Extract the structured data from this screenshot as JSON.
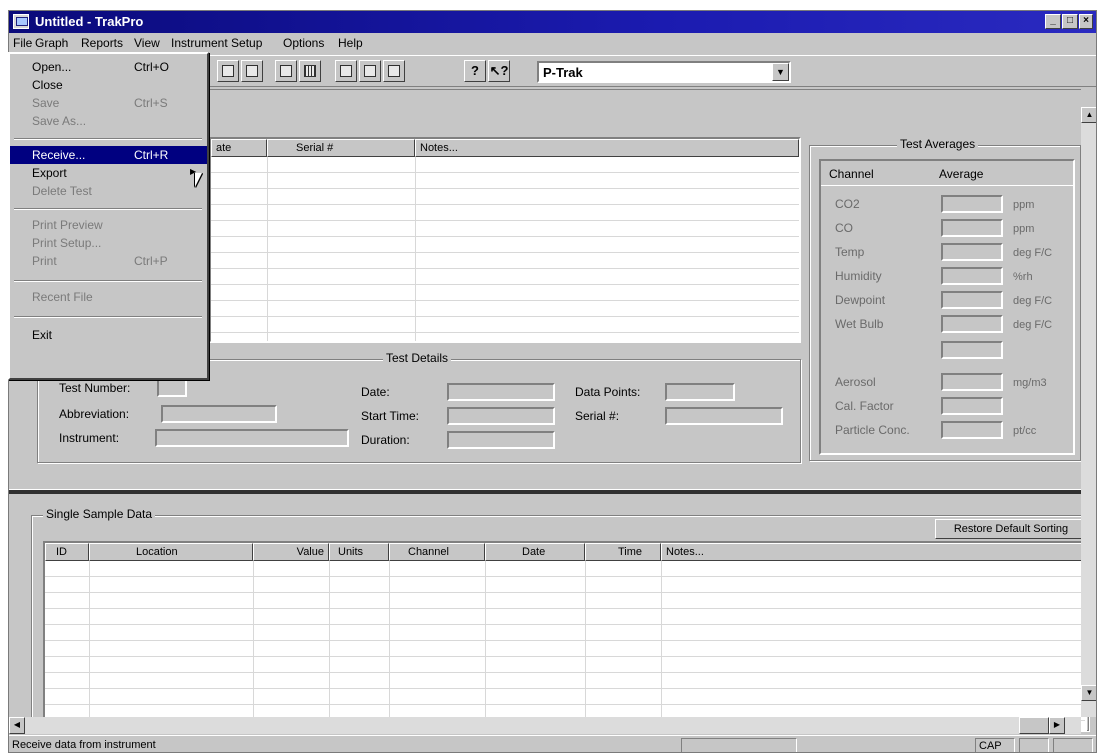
{
  "window": {
    "title": "Untitled - TrakPro"
  },
  "menubar": [
    "File",
    "Graph",
    "Reports",
    "View",
    "Instrument Setup",
    "Options",
    "Help"
  ],
  "toolbar": {
    "instrument_selected": "P-Trak"
  },
  "file_menu": {
    "open": {
      "label": "Open...",
      "shortcut": "Ctrl+O"
    },
    "close": {
      "label": "Close"
    },
    "save": {
      "label": "Save",
      "shortcut": "Ctrl+S"
    },
    "save_as": {
      "label": "Save As..."
    },
    "receive": {
      "label": "Receive...",
      "shortcut": "Ctrl+R"
    },
    "export": {
      "label": "Export"
    },
    "delete_test": {
      "label": "Delete Test"
    },
    "print_preview": {
      "label": "Print Preview"
    },
    "print_setup": {
      "label": "Print Setup..."
    },
    "print": {
      "label": "Print",
      "shortcut": "Ctrl+P"
    },
    "recent_file": {
      "label": "Recent File"
    },
    "exit": {
      "label": "Exit"
    }
  },
  "tests_table": {
    "columns": [
      "ate",
      "Serial #",
      "Notes..."
    ]
  },
  "test_details": {
    "title": "Test Details",
    "test_number": "Test Number:",
    "abbreviation": "Abbreviation:",
    "instrument": "Instrument:",
    "date": "Date:",
    "start_time": "Start Time:",
    "duration": "Duration:",
    "data_points": "Data Points:",
    "serial": "Serial #:"
  },
  "test_averages": {
    "title": "Test Averages",
    "col_channel": "Channel",
    "col_average": "Average",
    "rows": [
      {
        "channel": "CO2",
        "unit": "ppm"
      },
      {
        "channel": "CO",
        "unit": "ppm"
      },
      {
        "channel": "Temp",
        "unit": "deg F/C"
      },
      {
        "channel": "Humidity",
        "unit": "%rh"
      },
      {
        "channel": "Dewpoint",
        "unit": "deg F/C"
      },
      {
        "channel": "Wet Bulb",
        "unit": "deg F/C"
      },
      {
        "channel": "",
        "unit": ""
      },
      {
        "channel": "Aerosol",
        "unit": "mg/m3"
      },
      {
        "channel": "Cal. Factor",
        "unit": ""
      },
      {
        "channel": "Particle Conc.",
        "unit": "pt/cc"
      }
    ]
  },
  "single_sample": {
    "title": "Single Sample Data",
    "restore_button": "Restore Default Sorting",
    "columns": [
      "ID",
      "Location",
      "Value",
      "Units",
      "Channel",
      "Date",
      "Time",
      "Notes..."
    ]
  },
  "status": {
    "message": "Receive data from instrument",
    "cap": "CAP"
  }
}
